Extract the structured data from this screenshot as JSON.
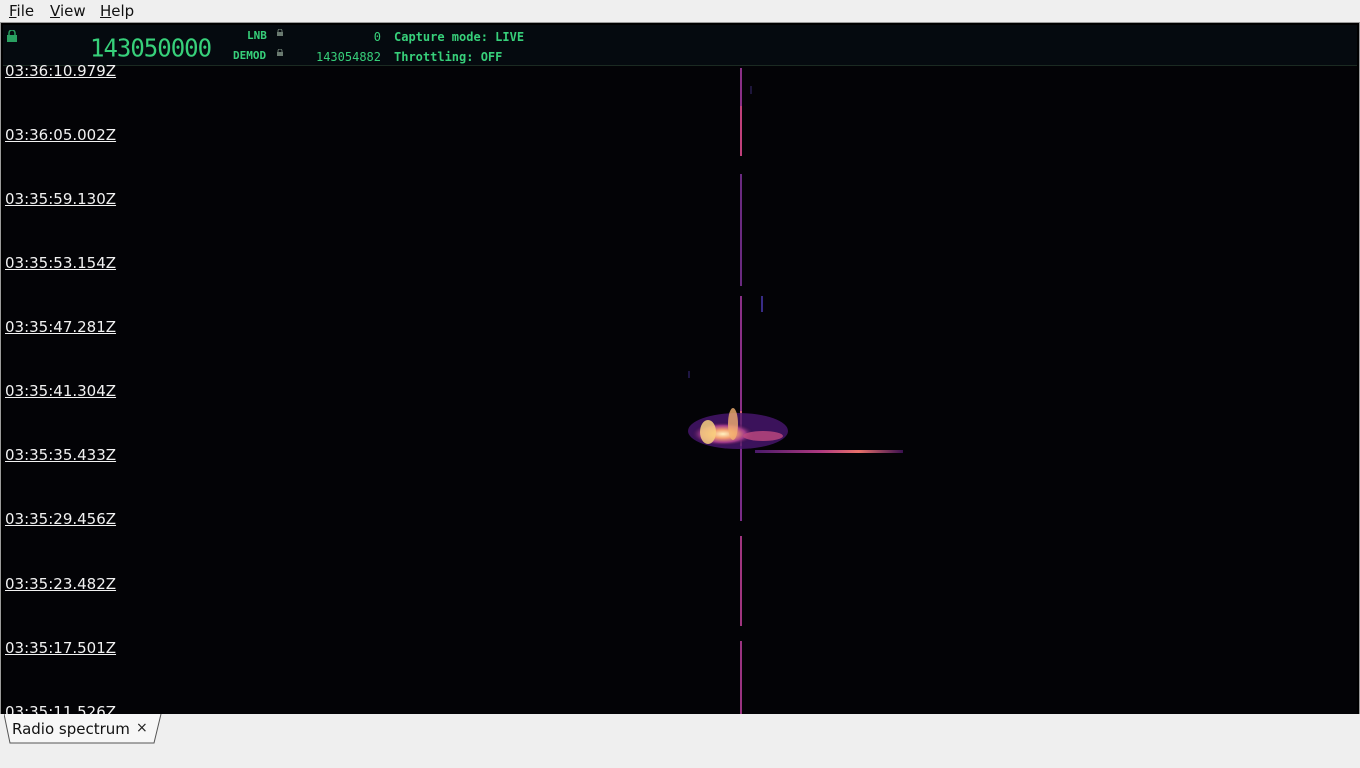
{
  "menu": {
    "file": "File",
    "view": "View",
    "help": "Help"
  },
  "status": {
    "main_frequency": "143050000",
    "lnb_label": "LNB",
    "lnb_value": "0",
    "demod_label": "DEMOD",
    "demod_value": "143054882",
    "capture_mode": "Capture mode: LIVE",
    "throttling": "Throttling: OFF",
    "text_color": "#37d07a"
  },
  "waterfall": {
    "timestamps": [
      "03:36:10.979Z",
      "03:36:05.002Z",
      "03:35:59.130Z",
      "03:35:53.154Z",
      "03:35:47.281Z",
      "03:35:41.304Z",
      "03:35:35.433Z",
      "03:35:29.456Z",
      "03:35:23.482Z",
      "03:35:17.501Z",
      "03:35:11.526Z"
    ],
    "colormap": "magma"
  },
  "tabs": [
    {
      "label": "Radio spectrum",
      "close": "×"
    }
  ]
}
